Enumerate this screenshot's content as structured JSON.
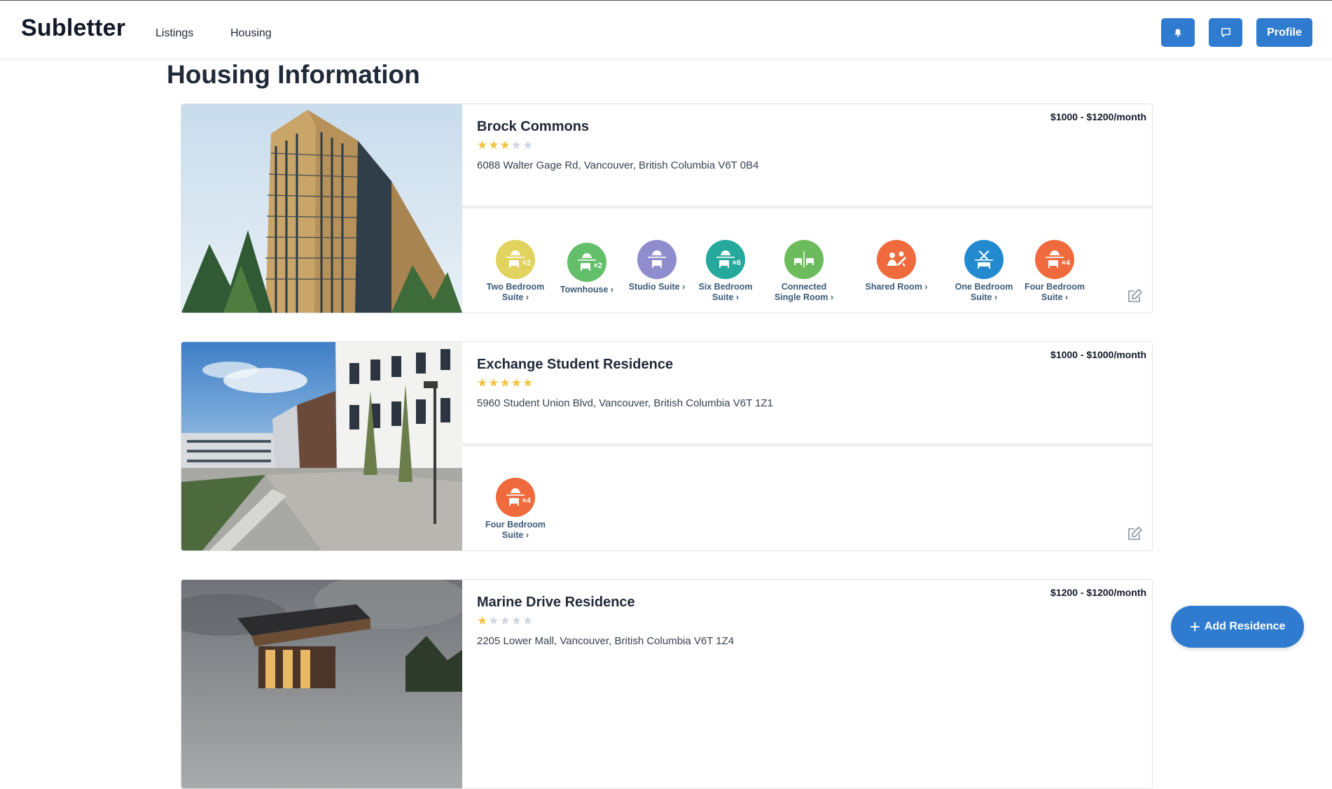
{
  "app": {
    "brand": "Subletter"
  },
  "nav": {
    "links": [
      "Listings",
      "Housing"
    ],
    "profile_label": "Profile",
    "icons": [
      "bell-icon",
      "chat-icon"
    ]
  },
  "page": {
    "title": "Housing Information"
  },
  "residences": [
    {
      "name": "Brock Commons",
      "rating": 3,
      "address": "6088 Walter Gage Rd, Vancouver, British Columbia V6T 0B4",
      "price": "$1000 - $1200/month",
      "room_types": [
        {
          "label": "Two Bedroom\nSuite ›",
          "color": "#e1d35e",
          "multiplier": "×2"
        },
        {
          "label": "Townhouse ›",
          "color": "#64bf6a",
          "multiplier": "×2"
        },
        {
          "label": "Studio Suite ›",
          "color": "#8f8dce",
          "multiplier": ""
        },
        {
          "label": "Six Bedroom\nSuite ›",
          "color": "#25a99c",
          "multiplier": "×6"
        },
        {
          "label": "Connected\nSingle Room ›",
          "color": "#6cbc5e",
          "multiplier": ""
        },
        {
          "label": "Shared Room ›",
          "color": "#ef6a3c",
          "multiplier": ""
        },
        {
          "label": "One Bedroom\nSuite ›",
          "color": "#238ad0",
          "multiplier": ""
        },
        {
          "label": "Four Bedroom\nSuite ›",
          "color": "#ef6a3c",
          "multiplier": "×4"
        }
      ]
    },
    {
      "name": "Exchange Student Residence",
      "rating": 5,
      "address": "5960 Student Union Blvd, Vancouver, British Columbia V6T 1Z1",
      "price": "$1000 - $1000/month",
      "room_types": [
        {
          "label": "Four Bedroom\nSuite ›",
          "color": "#ef6a3c",
          "multiplier": "×4"
        }
      ]
    },
    {
      "name": "Marine Drive Residence",
      "rating": 1,
      "address": "2205 Lower Mall, Vancouver, British Columbia V6T 1Z4",
      "price": "$1200 - $1200/month",
      "room_types": []
    }
  ],
  "actions": {
    "add_residence": "Add Residence"
  },
  "colors": {
    "primary": "#2f7bd0",
    "star": "#f0c43c",
    "star_off": "#cfd6e0"
  }
}
